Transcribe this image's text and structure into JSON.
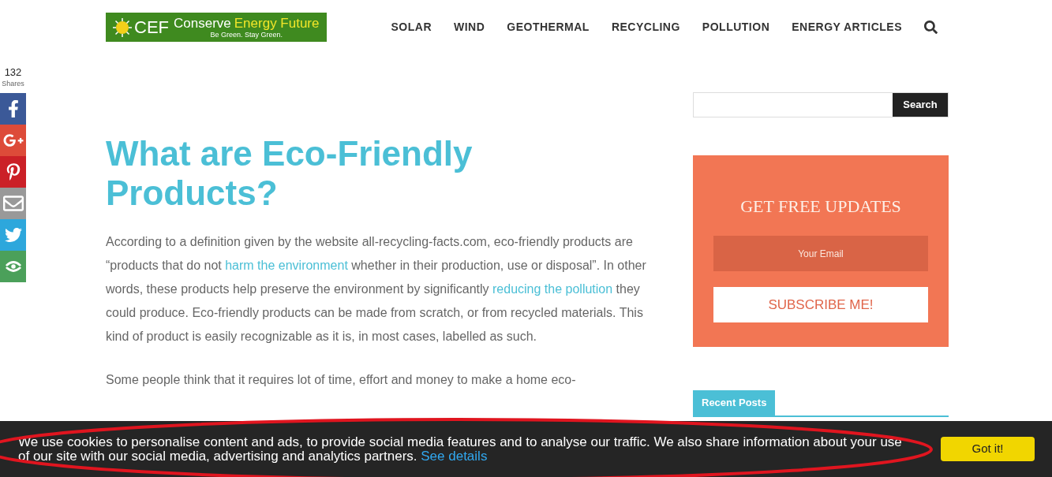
{
  "header": {
    "logo": {
      "letters": "CEF",
      "name_part_1": "Conserve",
      "name_part_2": "Energy Future",
      "tagline": "Be Green. Stay Green."
    },
    "nav": [
      "SOLAR",
      "WIND",
      "GEOTHERMAL",
      "RECYCLING",
      "POLLUTION",
      "ENERGY ARTICLES"
    ]
  },
  "share_bar": {
    "count": "132",
    "label": "Shares",
    "buttons": [
      {
        "kind": "facebook",
        "color": "#3b5998"
      },
      {
        "kind": "googleplus",
        "color": "#dd4b39"
      },
      {
        "kind": "pinterest",
        "color": "#cb2027"
      },
      {
        "kind": "email",
        "color": "#999999"
      },
      {
        "kind": "twitter",
        "color": "#2da7dc"
      },
      {
        "kind": "more",
        "color": "#4ba05a"
      }
    ]
  },
  "article": {
    "title": "What are Eco-Friendly Products?",
    "paragraphs": [
      [
        {
          "text": "According to a definition given by the website all-recycling-facts.com, eco-friendly products are “products that do not "
        },
        {
          "text": "harm the environment",
          "link": true
        },
        {
          "text": " whether in their production, use or disposal”. In other words, these products help preserve the environment by significantly "
        },
        {
          "text": "reducing the pollution",
          "link": true
        },
        {
          "text": " they could produce. Eco-friendly products can be made from scratch, or from recycled materials. This kind of product is easily recognizable as it is, in most cases, labelled as such."
        }
      ],
      [
        {
          "text": "Some people think that it requires lot of time, effort and money to make a home eco-"
        }
      ]
    ]
  },
  "sidebar": {
    "search_button": "Search",
    "newsletter": {
      "title": "GET FREE UPDATES",
      "email_placeholder": "Your Email",
      "button": "SUBSCRIBE ME!"
    },
    "recent_posts_tab": "Recent Posts"
  },
  "cookie_bar": {
    "message": "We use cookies to personalise content and ads, to provide social media features and to analyse our traffic. We also share information about your use of our site with our social media, advertising and analytics partners.",
    "link": "See details",
    "button": "Got it!"
  }
}
